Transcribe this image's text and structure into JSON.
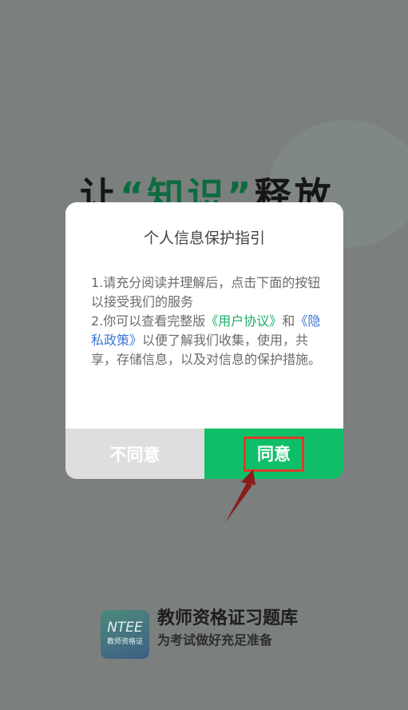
{
  "background": {
    "slogan_prefix": "让",
    "slogan_accent": "“知识”",
    "slogan_suffix": "释放"
  },
  "dialog": {
    "title": "个人信息保护指引",
    "para1": "1.请充分阅读并理解后，点击下面的按钮以接受我们的服务",
    "para2_prefix": "2.你可以查看完整版",
    "user_agreement_link": "《用户协议》",
    "para2_and": "和",
    "privacy_policy_link": "《隐私政策》",
    "para2_suffix": "以便了解我们收集，使用，共享，存储信息，以及对信息的保护措施。",
    "disagree_label": "不同意",
    "agree_label": "同意"
  },
  "brand": {
    "logo_main": "NTEE",
    "logo_sub": "教师资格证",
    "title": "教师资格证习题库",
    "tagline": "为考试做好充足准备"
  },
  "colors": {
    "agree": "#0fbf68",
    "disagree": "#dedede",
    "highlight": "#dd3b2b",
    "link_green": "#1aae6a",
    "link_blue": "#3c76d6"
  }
}
